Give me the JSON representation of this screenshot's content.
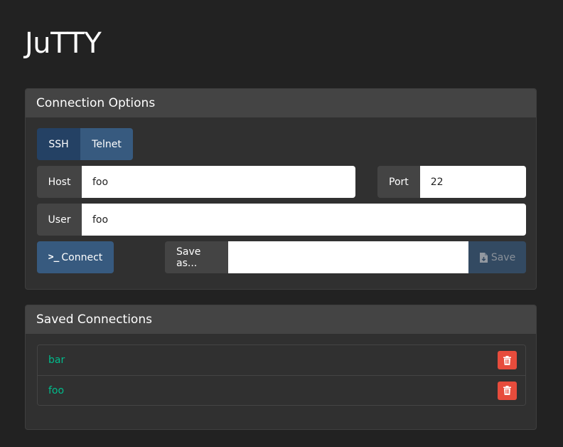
{
  "app": {
    "title": "JuTTY"
  },
  "connection_options": {
    "heading": "Connection Options",
    "protocols": [
      {
        "label": "SSH",
        "active": true
      },
      {
        "label": "Telnet",
        "active": false
      }
    ],
    "host": {
      "label": "Host",
      "value": "foo"
    },
    "port": {
      "label": "Port",
      "value": "22"
    },
    "user": {
      "label": "User",
      "value": "foo"
    },
    "connect": {
      "label": "Connect",
      "icon": "terminal-prompt-icon"
    },
    "save_as": {
      "label": "Save as...",
      "value": "",
      "placeholder": ""
    },
    "save": {
      "label": "Save",
      "icon": "save-file-icon",
      "disabled": true
    }
  },
  "saved_connections": {
    "heading": "Saved Connections",
    "items": [
      {
        "name": "bar"
      },
      {
        "name": "foo"
      }
    ]
  },
  "colors": {
    "background": "#222222",
    "panel": "#303030",
    "panel_heading": "#444444",
    "primary": "#375a7f",
    "primary_active": "#244164",
    "success_text": "#00bc8c",
    "danger": "#e74c3c"
  }
}
